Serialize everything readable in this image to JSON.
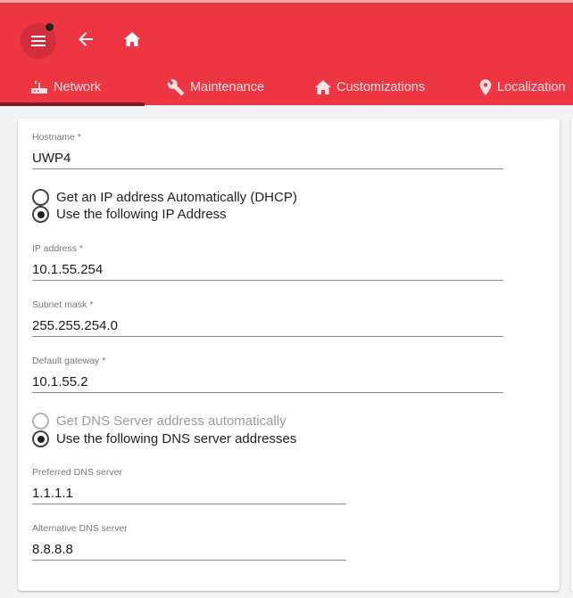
{
  "colors": {
    "accent": "#ee3542",
    "tab_indicator": "#7a1d25"
  },
  "toolbar": {
    "menu_icon": "hamburger-icon",
    "back_icon": "arrow-left-icon",
    "home_icon": "home-icon"
  },
  "tabs": [
    {
      "label": "Network",
      "icon": "router-icon",
      "active": true
    },
    {
      "label": "Maintenance",
      "icon": "wrench-icon",
      "active": false
    },
    {
      "label": "Customizations",
      "icon": "home-icon",
      "active": false
    },
    {
      "label": "Localization",
      "icon": "map-pin-icon",
      "active": false
    }
  ],
  "form": {
    "hostname": {
      "label": "Hostname *",
      "value": "UWP4"
    },
    "ip_mode": {
      "options": [
        "Get an IP address Automatically (DHCP)",
        "Use the following IP Address"
      ],
      "selected": "Use the following IP Address"
    },
    "ip_address": {
      "label": "IP address *",
      "value": "10.1.55.254"
    },
    "subnet_mask": {
      "label": "Subnet mask *",
      "value": "255.255.254.0"
    },
    "default_gateway": {
      "label": "Default gateway *",
      "value": "10.1.55.2"
    },
    "dns_mode": {
      "options": [
        "Get DNS Server address automatically",
        "Use the following DNS server addresses"
      ],
      "selected": "Use the following DNS server addresses",
      "disabled": [
        "Get DNS Server address automatically"
      ]
    },
    "preferred_dns": {
      "label": "Preferred DNS server",
      "value": "1.1.1.1"
    },
    "alternative_dns": {
      "label": "Alternative DNS server",
      "value": "8.8.8.8"
    }
  }
}
